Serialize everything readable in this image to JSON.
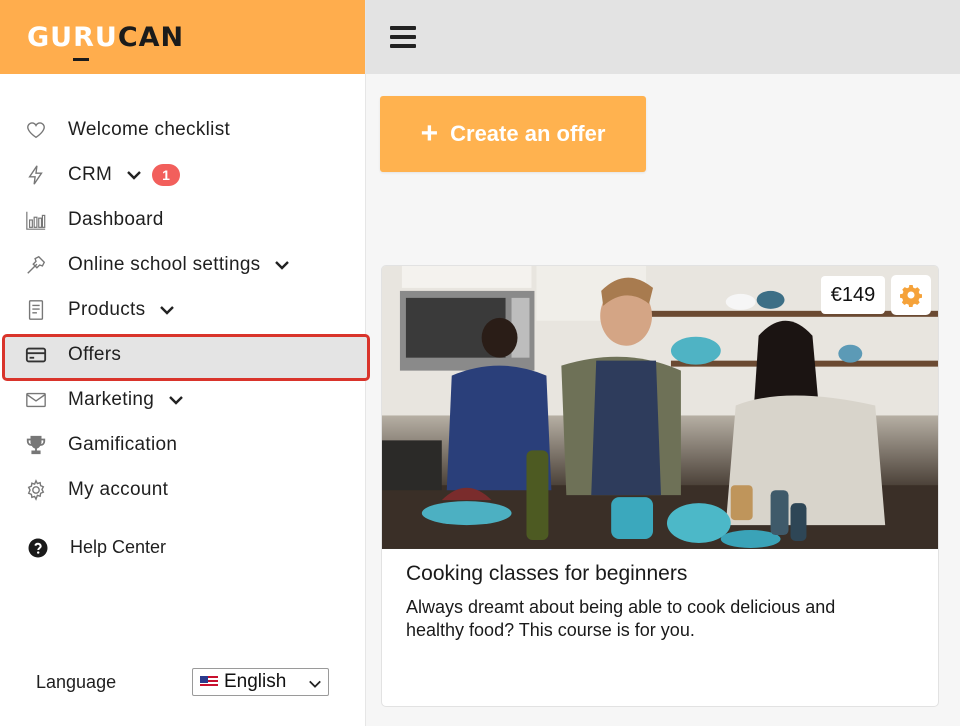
{
  "brand": {
    "logo_text_a": "GU",
    "logo_text_u": "RU",
    "logo_text_b": "CAN"
  },
  "sidebar": {
    "items": [
      {
        "label": "Welcome checklist",
        "icon": "heart-icon"
      },
      {
        "label": "CRM",
        "icon": "bolt-icon",
        "badge": "1"
      },
      {
        "label": "Dashboard",
        "icon": "bar-chart-icon"
      },
      {
        "label": "Online school settings",
        "icon": "hammer-icon"
      },
      {
        "label": "Products",
        "icon": "document-icon"
      },
      {
        "label": "Offers",
        "icon": "credit-card-icon",
        "selected": true
      },
      {
        "label": "Marketing",
        "icon": "envelope-icon"
      },
      {
        "label": "Gamification",
        "icon": "trophy-icon"
      },
      {
        "label": "My account",
        "icon": "gear-icon"
      }
    ],
    "help": "Help Center",
    "language_label": "Language",
    "language_value": "English"
  },
  "main": {
    "create_button": "Create an offer",
    "offer": {
      "price": "€149",
      "title": "Cooking classes for beginners",
      "description": "Always dreamt about being able to cook delicious and healthy food? This course is for you."
    }
  },
  "colors": {
    "brand_orange": "#ffad4d",
    "button_orange": "#ffb24f",
    "badge_red": "#f25f5c",
    "highlight_red": "#d9342b"
  }
}
